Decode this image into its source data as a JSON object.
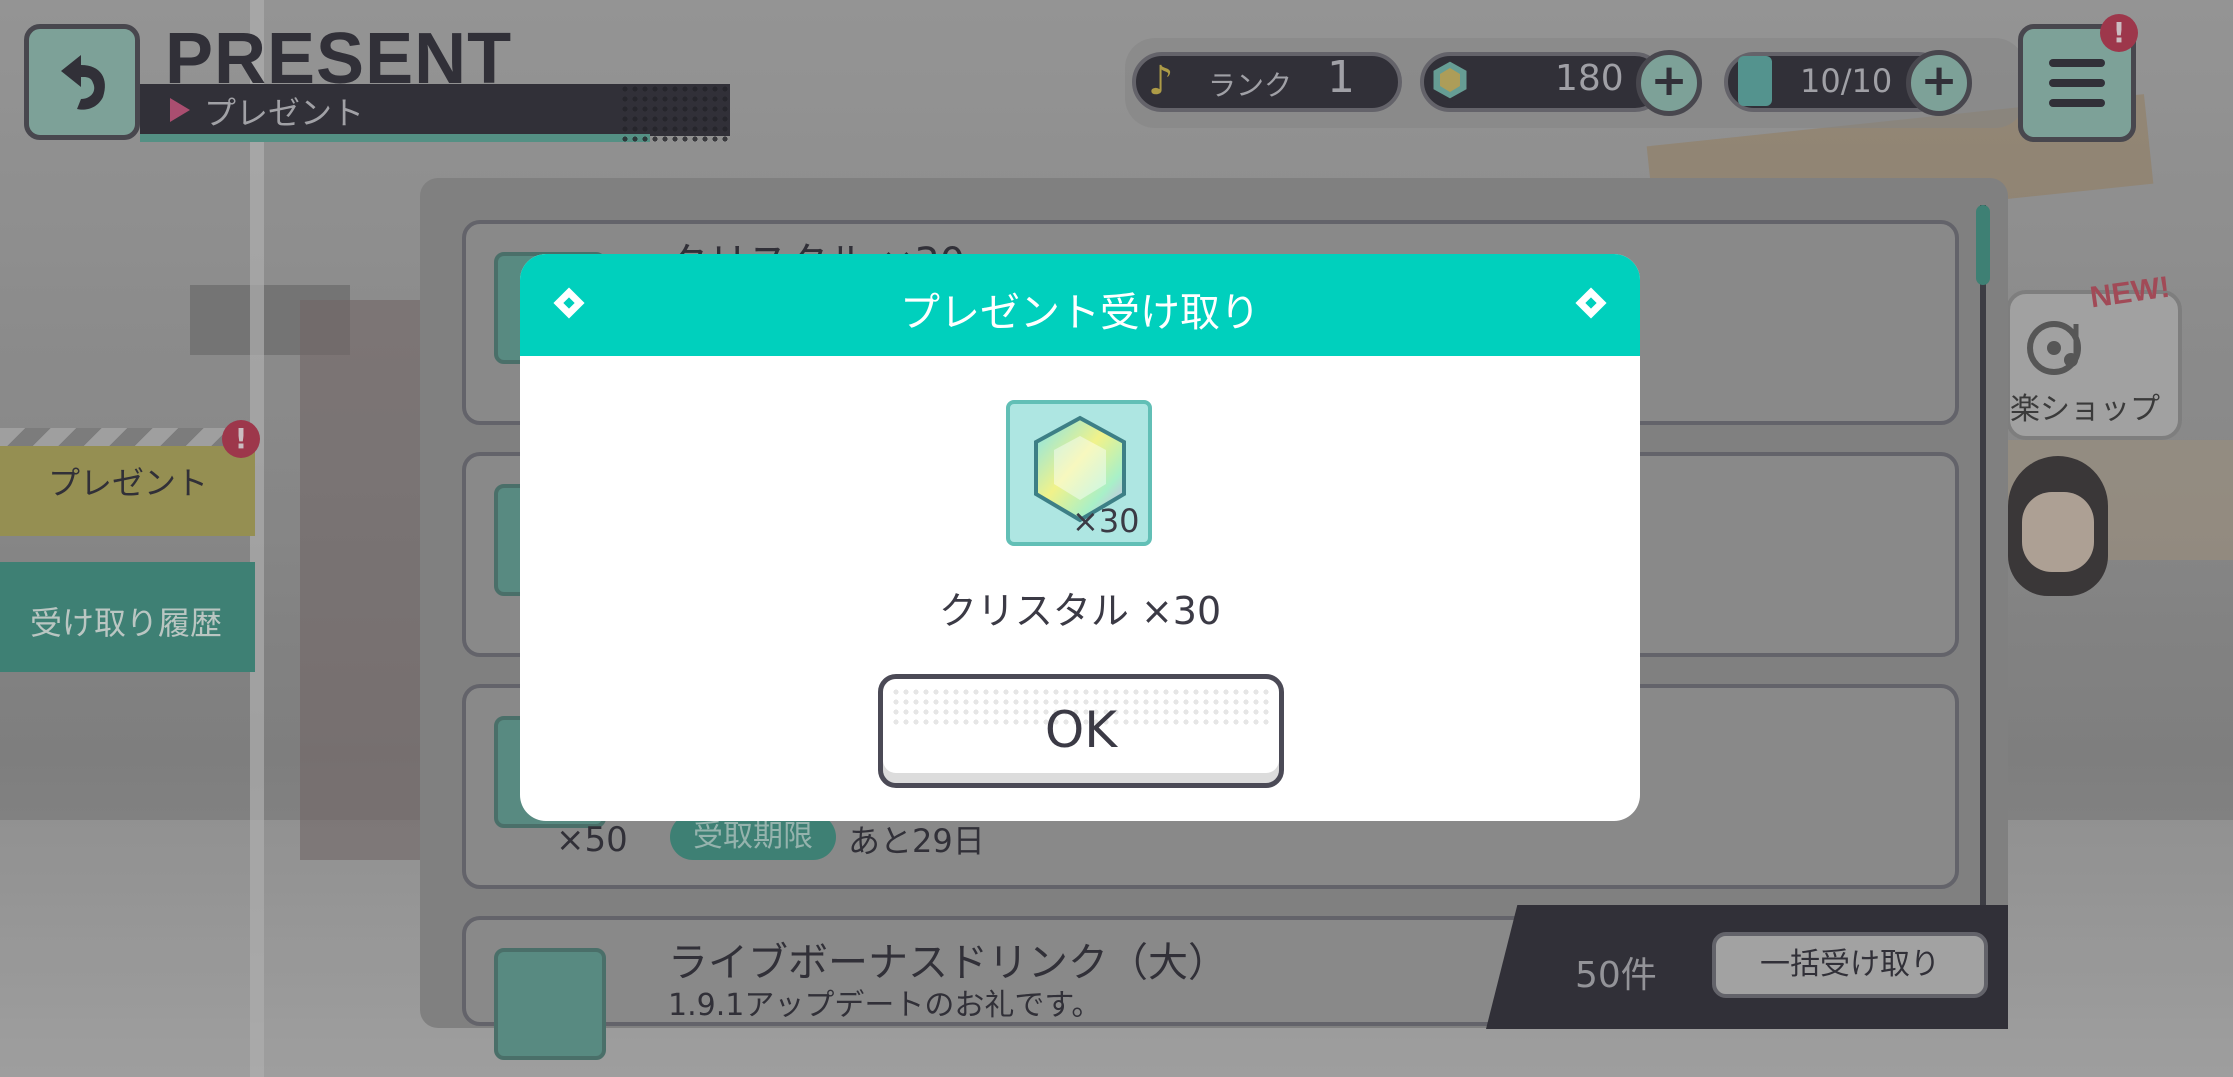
{
  "header": {
    "title": "PRESENT",
    "subtitle": "プレゼント"
  },
  "status": {
    "rank_label": "ランク",
    "rank_value": "1",
    "crystal_value": "180",
    "energy_value": "10/10",
    "plus_symbol": "+"
  },
  "sidebar": {
    "items": [
      {
        "label": "プレゼント",
        "active": true
      },
      {
        "label": "受け取り履歴",
        "active": false
      }
    ],
    "badge": "!"
  },
  "menu": {
    "badge": "!"
  },
  "shop_npc": {
    "new_label": "NEW!",
    "label": "楽ショップ"
  },
  "list": {
    "rows": [
      {
        "title": "クリスタル ×30"
      },
      {
        "qty": "×50",
        "limit_label": "受取期限",
        "limit_value": "あと29日"
      },
      {
        "title": "ライブボーナスドリンク（大）",
        "desc": "1.9.1アップデートのお礼です。"
      }
    ],
    "count": "50件",
    "bulk_button": "一括受け取り"
  },
  "modal": {
    "title": "プレゼント受け取り",
    "reward_qty": "×30",
    "reward_name": "クリスタル ×30",
    "ok_label": "OK"
  },
  "colors": {
    "accent": "#00d0bd",
    "dark": "#2f2e37",
    "badge": "#b2364f"
  }
}
